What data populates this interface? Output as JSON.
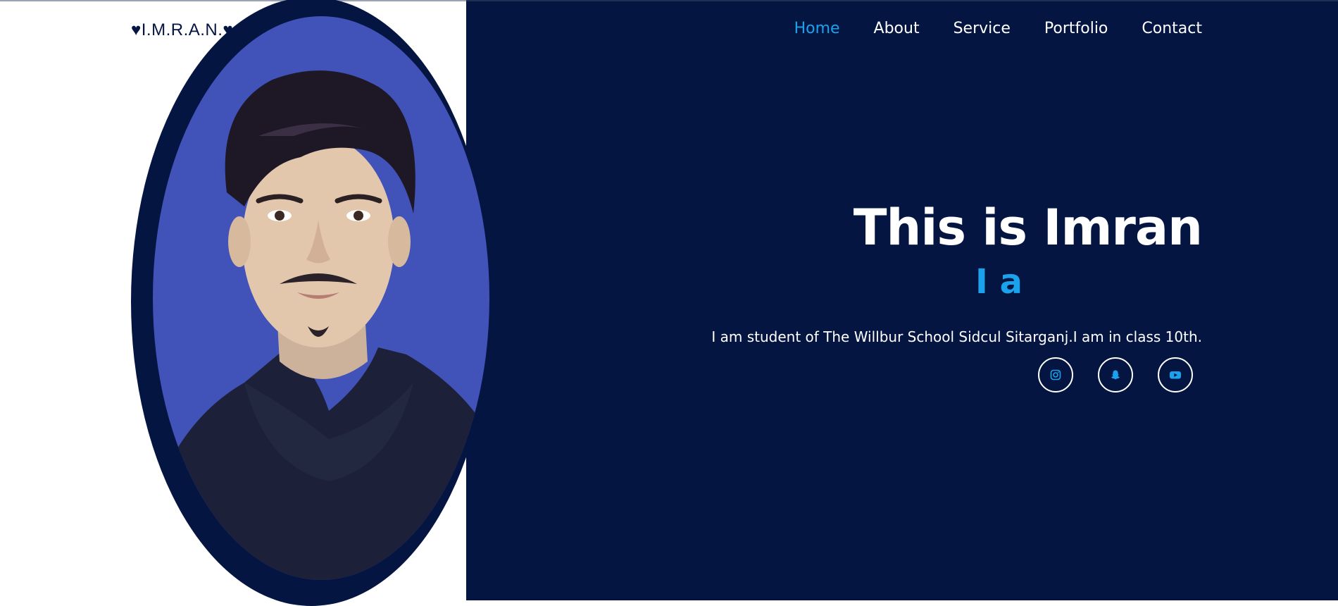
{
  "brand": {
    "logo_text": "♥I.M.R.A.N.♥"
  },
  "nav": {
    "items": [
      {
        "label": "Home",
        "active": true
      },
      {
        "label": "About",
        "active": false
      },
      {
        "label": "Service",
        "active": false
      },
      {
        "label": "Portfolio",
        "active": false
      },
      {
        "label": "Contact",
        "active": false
      }
    ]
  },
  "hero": {
    "title": "This is Imran",
    "typed_text": "I a",
    "description": "I am student of The Willbur School Sidcul Sitarganj.I am in class 10th."
  },
  "social": {
    "icons": [
      "instagram-icon",
      "snapchat-icon",
      "youtube-icon"
    ]
  },
  "colors": {
    "navy": "#051542",
    "accent": "#1aa3ec",
    "portrait_bg": "#4152b8",
    "white": "#ffffff"
  }
}
